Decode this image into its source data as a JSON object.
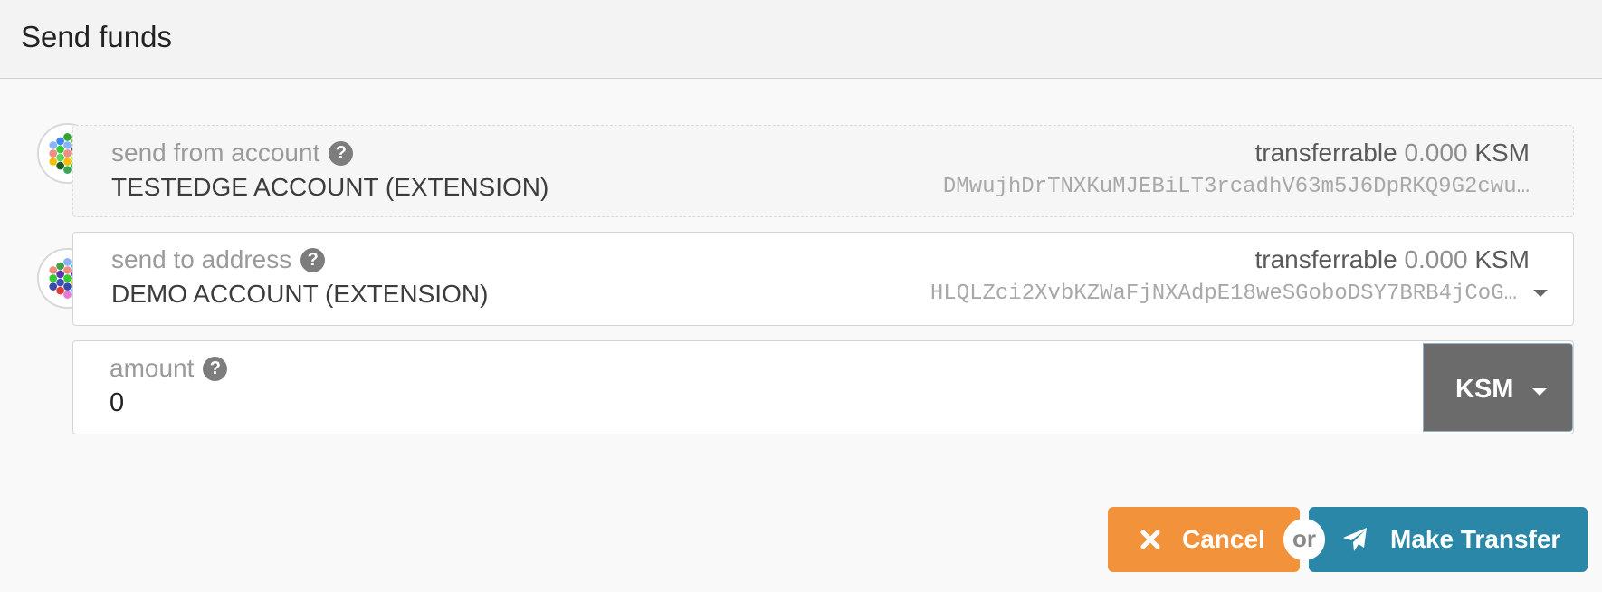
{
  "header": {
    "title": "Send funds"
  },
  "from": {
    "label": "send from account",
    "help_icon": "question-circle-icon",
    "transferrable_label": "transferrable",
    "transferrable_value": "0.000",
    "transferrable_unit": "KSM",
    "account_name": "TESTEDGE ACCOUNT (EXTENSION)",
    "address": "DMwujhDrTNXKuMJEBiLT3rcadhV63m5J6DpRKQ9G2cwu…",
    "identicon_colors": [
      "#2ea52e",
      "#8ab4f8",
      "#f28b82",
      "#fbbc04",
      "#34a853",
      "#4285f4",
      "#33cc33",
      "#5bd75b",
      "#1b5e20",
      "#7cb342",
      "#3c4043",
      "#a3e635"
    ]
  },
  "to": {
    "label": "send to address",
    "help_icon": "question-circle-icon",
    "transferrable_label": "transferrable",
    "transferrable_value": "0.000",
    "transferrable_unit": "KSM",
    "account_name": "DEMO ACCOUNT (EXTENSION)",
    "address": "HLQLZci2XvbKZWaFjNXAdpE18weSGoboDSY7BRB4jCoG…",
    "identicon_colors": [
      "#8ab4f8",
      "#f28b82",
      "#33cc33",
      "#3949ab",
      "#e57ad4",
      "#43a047",
      "#5e35b1",
      "#3f51b5",
      "#e53935",
      "#4fc3f7",
      "#6a1b9a",
      "#c0ca33"
    ]
  },
  "amount": {
    "label": "amount",
    "help_icon": "question-circle-icon",
    "value": "0",
    "unit": "KSM"
  },
  "actions": {
    "cancel_label": "Cancel",
    "or_label": "or",
    "transfer_label": "Make Transfer"
  },
  "colors": {
    "cancel": "#f2923a",
    "transfer": "#2b87a7",
    "unit_dropdown": "#6b6b6b"
  }
}
